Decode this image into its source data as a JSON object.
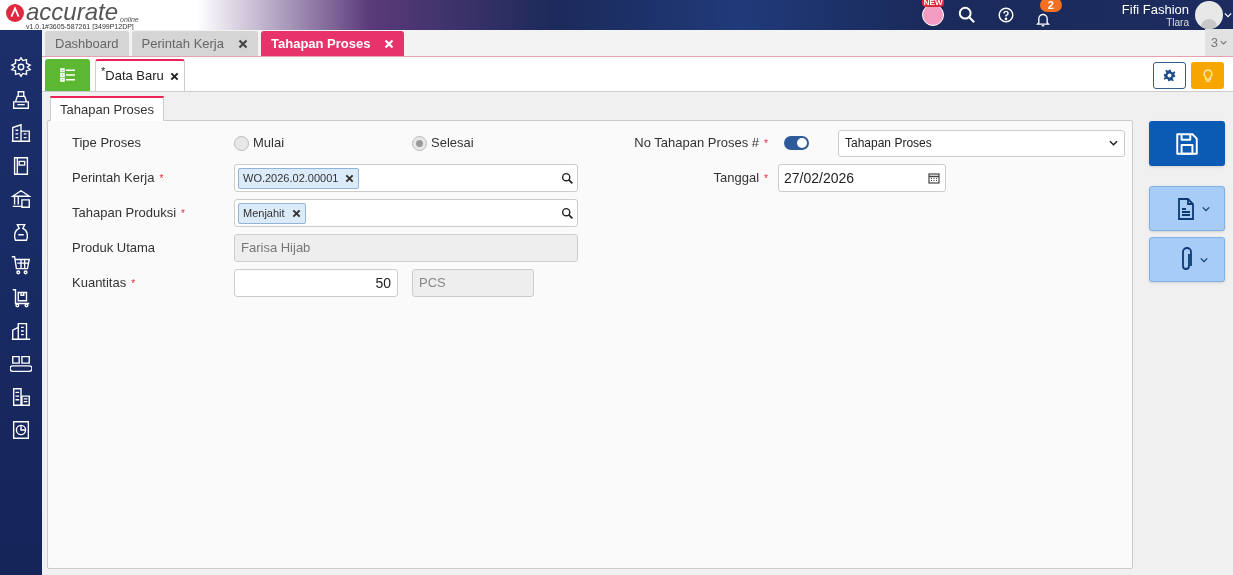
{
  "header": {
    "logo_text": "accurate",
    "logo_sub": "online",
    "version": "v1.0.1#3605-587261 [3499P12DP]",
    "new_badge": "NEW",
    "notification_count": "2",
    "company": "Fifi Fashion",
    "user": "Tlara"
  },
  "tabs": [
    {
      "label": "Dashboard",
      "closable": false,
      "selected": false
    },
    {
      "label": "Perintah Kerja",
      "closable": true,
      "selected": false
    },
    {
      "label": "Tahapan Proses",
      "closable": true,
      "selected": true
    }
  ],
  "tab_overflow": "3",
  "subtabs": [
    {
      "label": "Data Baru",
      "modified_mark": "*",
      "selected": true
    }
  ],
  "form_tab": "Tahapan Proses",
  "left_fields": [
    {
      "kind": "radio",
      "label": "Tipe Proses",
      "options": [
        {
          "label": "Mulai",
          "selected": false
        },
        {
          "label": "Selesai",
          "selected": true
        }
      ]
    },
    {
      "kind": "chip",
      "label": "Perintah Kerja",
      "required_mark": "*",
      "chip": "WO.2026.02.00001"
    },
    {
      "kind": "chip",
      "label": "Tahapan Produksi",
      "required_mark": "*",
      "chip": "Menjahit"
    },
    {
      "kind": "readonly",
      "label": "Produk Utama",
      "value": "Farisa Hijab"
    },
    {
      "kind": "quantity",
      "label": "Kuantitas",
      "required_mark": "*",
      "value": "50",
      "unit": "PCS"
    }
  ],
  "right_fields": [
    {
      "kind": "numbering",
      "label": "No Tahapan Proses #",
      "required_mark": "*",
      "on": true,
      "value": "Tahapan Proses"
    },
    {
      "kind": "date",
      "label": "Tanggal",
      "required_mark": "*",
      "value": "27/02/2026"
    }
  ]
}
